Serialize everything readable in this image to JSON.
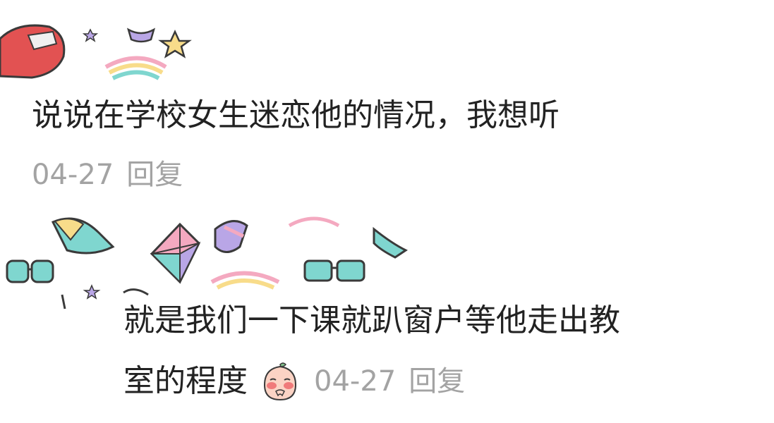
{
  "comment": {
    "text": "说说在学校女生迷恋他的情况，我想听",
    "date": "04-27",
    "reply_label": "回复"
  },
  "reply": {
    "text_line1": "就是我们一下课就趴窗户等他走出教",
    "text_line2": "室的程度",
    "emoji_icon": "blushing-peach-emoji-icon",
    "date": "04-27",
    "reply_label": "回复"
  },
  "colors": {
    "text": "#222222",
    "meta": "#a3a3a3",
    "teal": "#7fd6cf",
    "lavender": "#b9a6e6",
    "pink": "#f4a9c0",
    "yellow": "#f8dc8a",
    "red": "#e25252"
  }
}
